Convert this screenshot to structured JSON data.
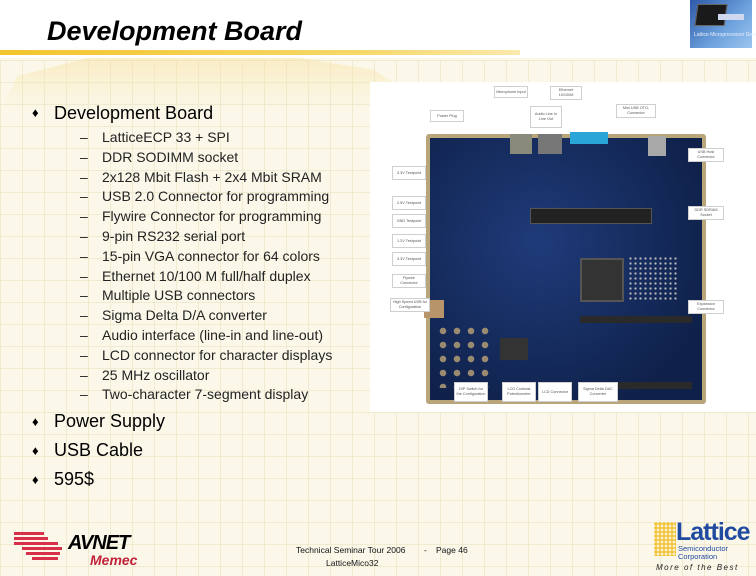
{
  "slide": {
    "title": "Development Board",
    "footer": {
      "line1": "Technical Seminar Tour 2006",
      "separator": "-",
      "page": "Page 46",
      "line2": "LatticeMico32"
    },
    "logos": {
      "left_brand": "AVNET",
      "left_sub": "Memec",
      "right_brand": "Lattice",
      "right_sub1": "Semiconductor",
      "right_sub2": "Corporation",
      "right_tagline": "More of the Best",
      "corner_caption": "Lattice Microprocessor Design Service"
    }
  },
  "bullets": {
    "main": {
      "label": "Development Board",
      "items": [
        "LatticeECP 33 + SPI",
        "DDR SODIMM socket",
        "2x128 Mbit Flash + 2x4 Mbit SRAM",
        "USB 2.0 Connector for programming",
        "Flywire Connector for programming",
        "9-pin RS232 serial port",
        "15-pin VGA connector for 64 colors",
        "Ethernet 10/100 M full/half duplex",
        "Multiple USB connectors",
        "Sigma Delta D/A converter",
        "Audio interface (line-in and line-out)",
        "LCD connector for character displays",
        "25 MHz oscillator",
        "Two-character 7-segment display"
      ]
    },
    "others": [
      "Power Supply",
      "USB Cable",
      "595$"
    ]
  },
  "board_callouts": {
    "top": [
      "Power Plug",
      "Microphone Input",
      "Audio Line In Line Out",
      "Ethernet 10/100M",
      "Mini USB OTG-Connector"
    ],
    "left": [
      "3.3V Testpoint",
      "2.5V Testpoint",
      "GND Testpoint",
      "1.2V Testpoint",
      "3.3V Testpoint",
      "Flywire Connector",
      "High Speed USB for Configuration"
    ],
    "right": [
      "USB Host Connector",
      "DDR SDRAM Socket",
      "Expansion Connector"
    ],
    "bottom": [
      "DIP Switch for the Configuration",
      "LCD Contrast Potentiometer",
      "LCD Connector",
      "Sigma Delta DAC Converter"
    ]
  }
}
